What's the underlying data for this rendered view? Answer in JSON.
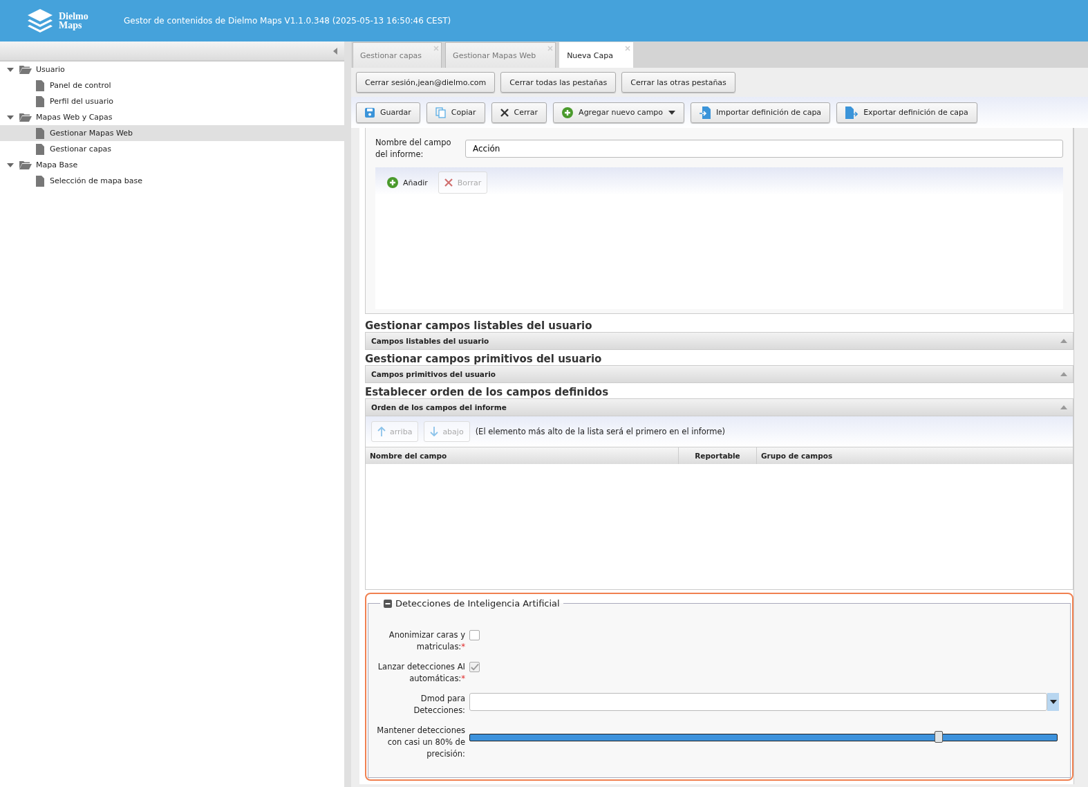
{
  "header": {
    "logo_text": [
      "Dielmo",
      "Maps"
    ],
    "title": "Gestor de contenidos de Dielmo Maps V1.1.0.348 (2025-05-13 16:50:46 CEST)"
  },
  "sidebar": {
    "items": [
      {
        "label": "Usuario",
        "expanded": true,
        "selected": false,
        "children": [
          {
            "label": "Panel de control",
            "selected": false
          },
          {
            "label": "Perfil del usuario",
            "selected": false
          }
        ]
      },
      {
        "label": "Mapas Web y Capas",
        "expanded": true,
        "selected": false,
        "children": [
          {
            "label": "Gestionar Mapas Web",
            "selected": true
          },
          {
            "label": "Gestionar capas",
            "selected": false
          }
        ]
      },
      {
        "label": "Mapa Base",
        "expanded": true,
        "selected": false,
        "children": [
          {
            "label": "Selección de mapa base",
            "selected": false
          }
        ]
      }
    ]
  },
  "tabs": [
    {
      "label": "Gestionar capas",
      "selected": false
    },
    {
      "label": "Gestionar Mapas Web",
      "selected": false
    },
    {
      "label": "Nueva Capa",
      "selected": true
    }
  ],
  "session_buttons": [
    "Cerrar sesión,jean@dielmo.com",
    "Cerrar todas las pestañas",
    "Cerrar las otras pestañas"
  ],
  "toolbar": [
    {
      "label": "Guardar",
      "kind": "save"
    },
    {
      "label": "Copiar",
      "kind": "copy"
    },
    {
      "label": "Cerrar",
      "kind": "close"
    },
    {
      "label": "Agregar nuevo campo",
      "kind": "add"
    },
    {
      "label": "Importar definición de capa",
      "kind": "import"
    },
    {
      "label": "Exportar definición de capa",
      "kind": "export"
    }
  ],
  "report_field": {
    "label": "Nombre del campo del informe:",
    "value": "Acción",
    "buttons": [
      {
        "label": "Añadir",
        "kind": "add",
        "disabled": false
      },
      {
        "label": "Borrar",
        "kind": "delete",
        "disabled": true
      }
    ]
  },
  "sections": [
    {
      "heading": "Gestionar campos listables del usuario",
      "panel": "Campos listables del usuario"
    },
    {
      "heading": "Gestionar campos primitivos del usuario",
      "panel": "Campos primitivos del usuario"
    },
    {
      "heading": "Establecer orden de los campos definidos",
      "panel": "Orden de los campos del informe"
    }
  ],
  "order": {
    "buttons": [
      {
        "label": "arriba",
        "kind": "up",
        "disabled": true
      },
      {
        "label": "abajo",
        "kind": "down",
        "disabled": true
      }
    ],
    "hint": "(El elemento más alto de la lista será el primero en el informe)",
    "columns": [
      "Nombre del campo",
      "Reportable",
      "Grupo de campos"
    ]
  },
  "ai": {
    "legend": "Detecciones de Inteligencia Artificial",
    "expanded": true,
    "fields": [
      {
        "kind": "checkbox",
        "label": "Anonimizar caras y matriculas:",
        "required": true,
        "checked": false
      },
      {
        "kind": "checkbox",
        "label": "Lanzar detecciones AI automáticas:",
        "required": true,
        "checked": true
      },
      {
        "kind": "select",
        "label": "Dmod para Detecciones:",
        "required": false
      },
      {
        "kind": "slider",
        "label": "Mantener detecciones con casi un 80% de precisión:",
        "required": false,
        "level": 0.8
      }
    ],
    "required_mark": "*"
  }
}
